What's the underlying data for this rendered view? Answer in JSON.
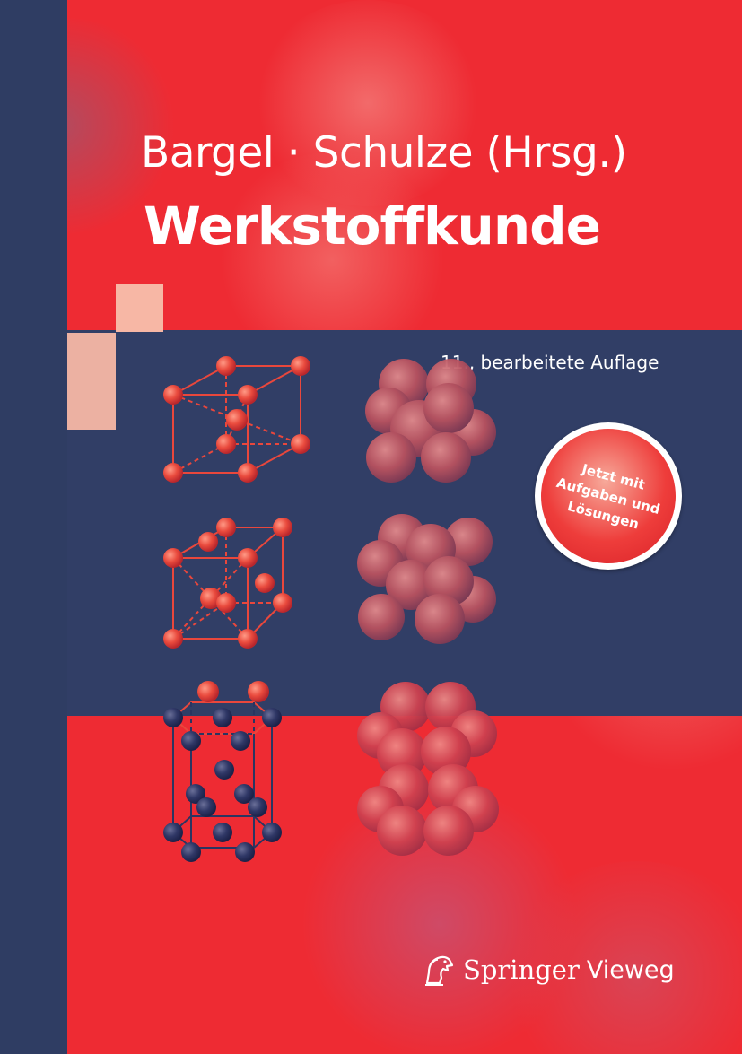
{
  "cover": {
    "authors": "Bargel · Schulze (Hrsg.)",
    "title": "Werkstoffkunde",
    "edition": "11., bearbeitete Auflage",
    "badge_text": [
      "Jetzt mit",
      "Aufgaben und",
      "Lösungen"
    ],
    "publisher": "Springer",
    "imprint": "Vieweg",
    "logo_icon": "springer-horse-logo",
    "colors": {
      "background_red": "#ee2b33",
      "navy": "#313e66",
      "accent_pink": "#f7b7a5",
      "lattice_red": "#e9473c",
      "lattice_navy": "#2a3561"
    }
  }
}
